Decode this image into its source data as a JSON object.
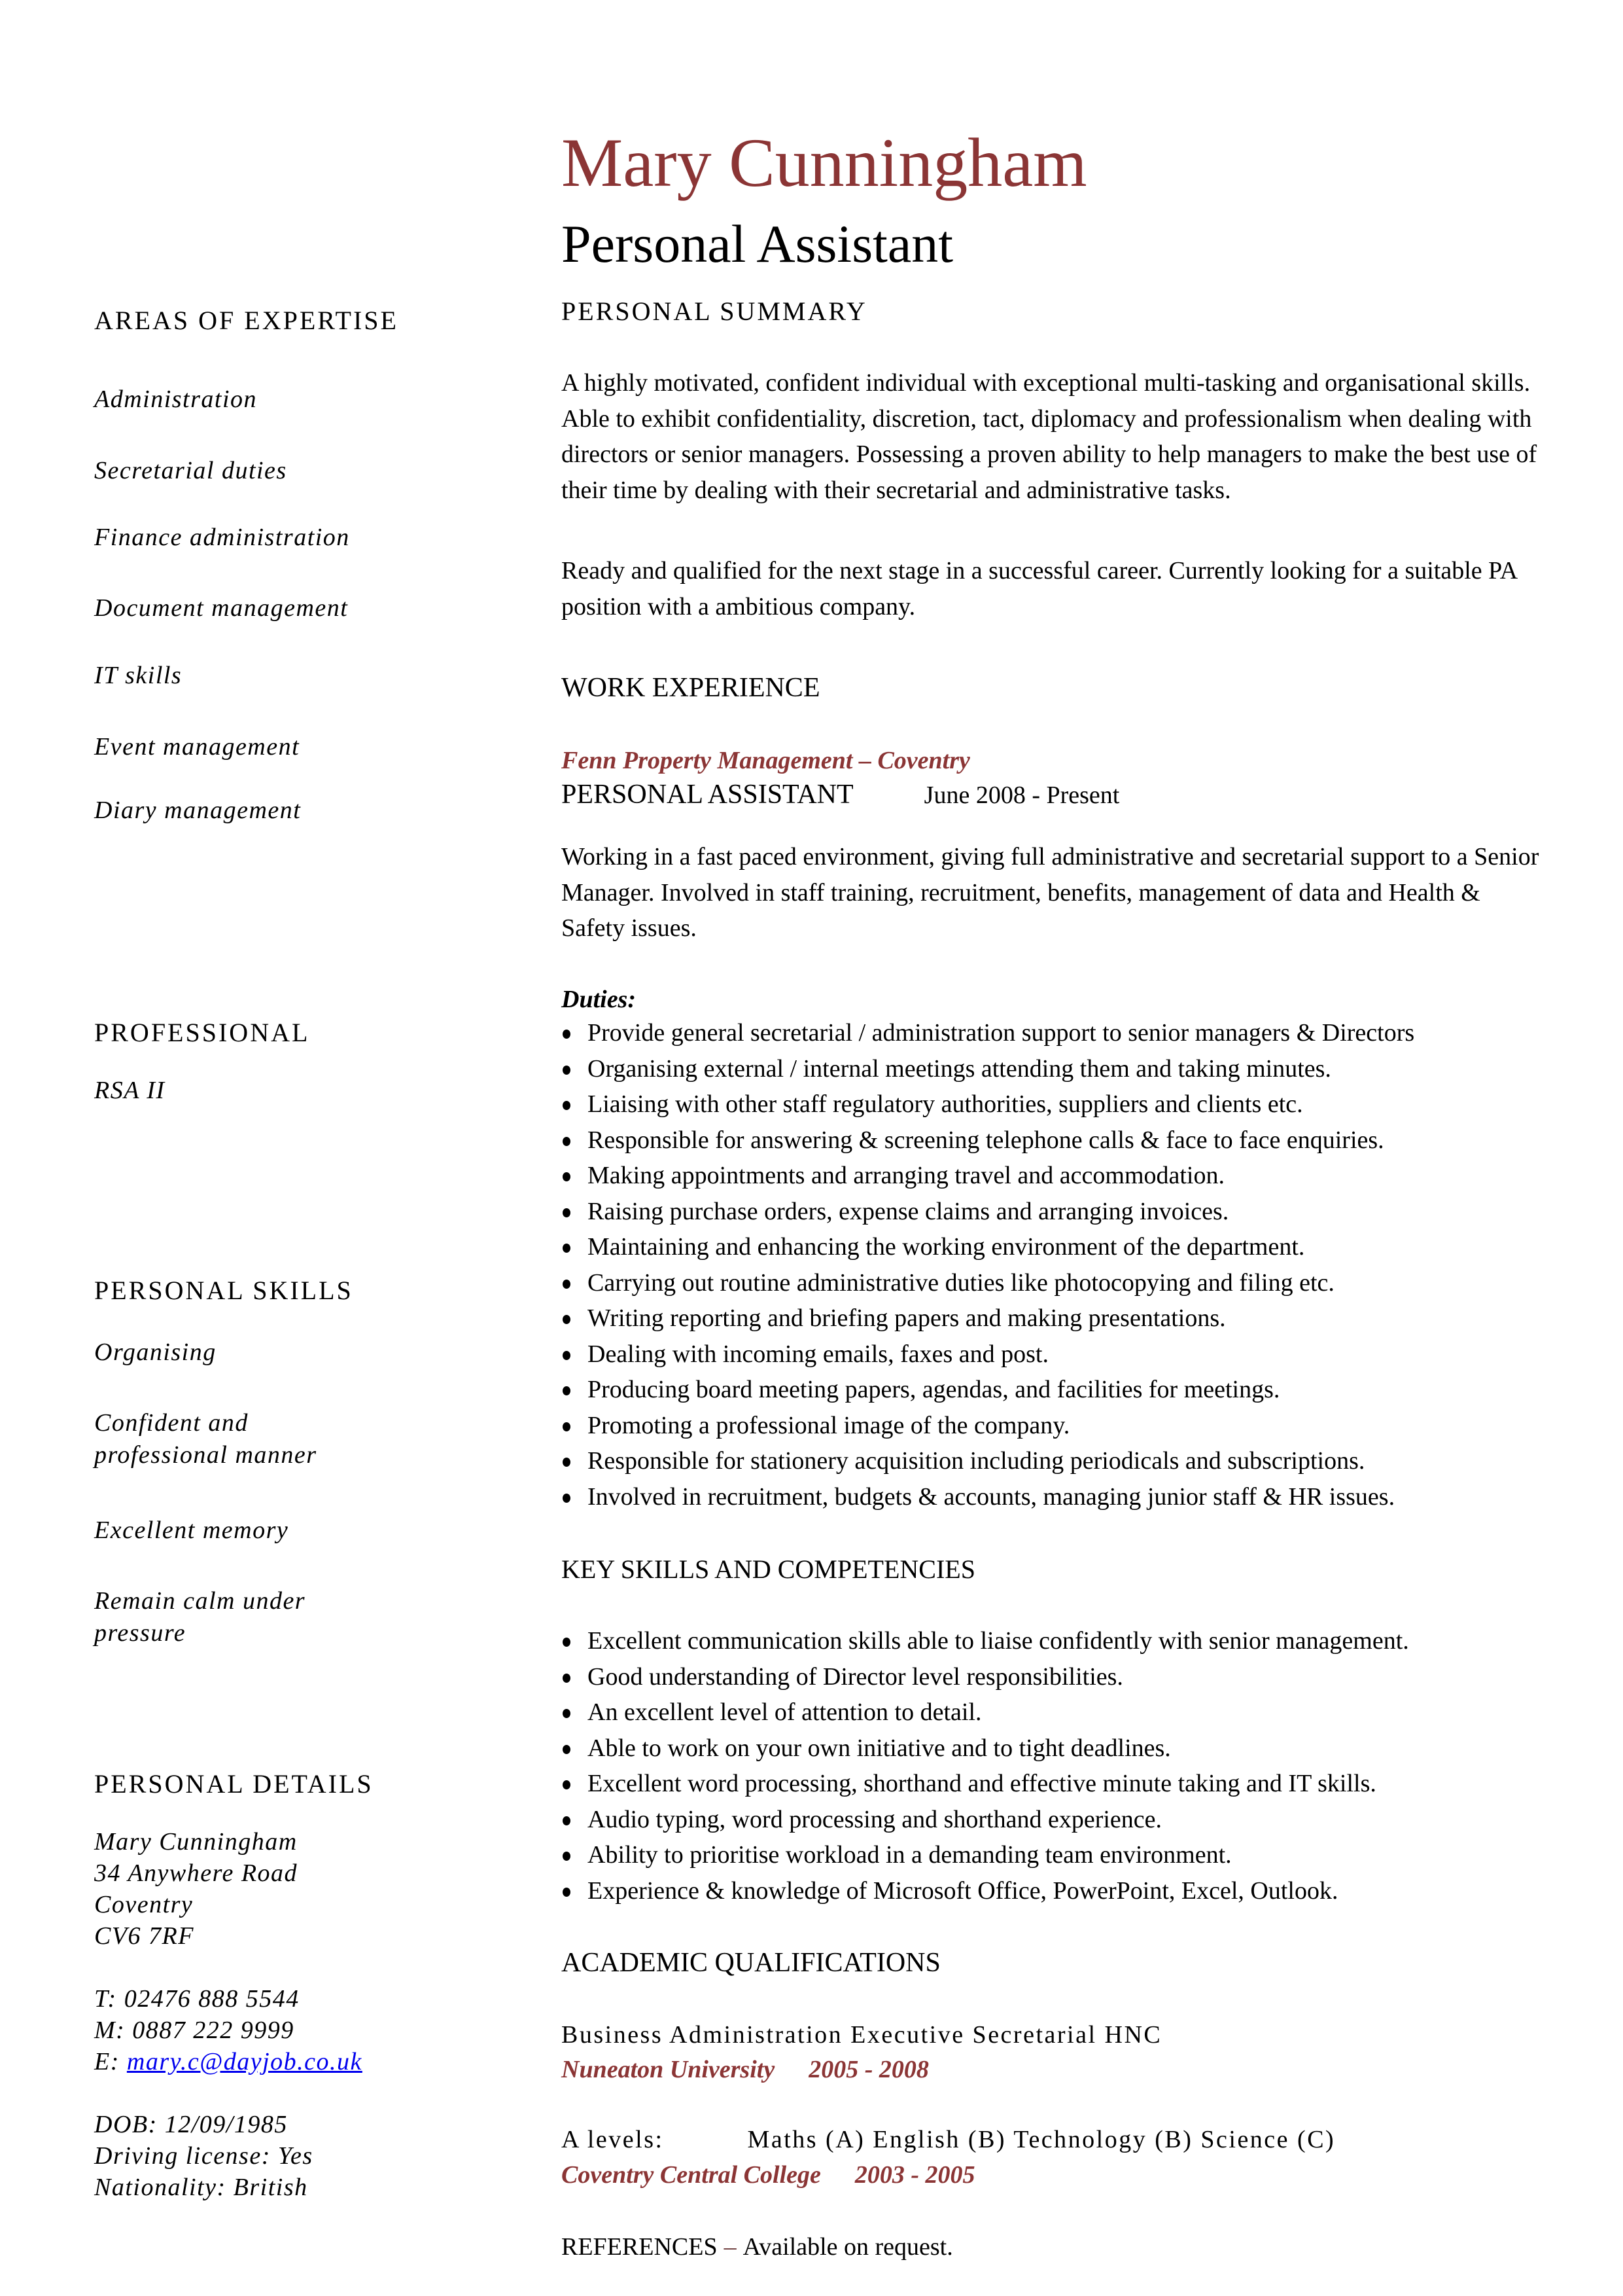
{
  "header": {
    "name": "Mary Cunningham",
    "job_title": "Personal Assistant",
    "accent_color": "#8B3535"
  },
  "left_column": {
    "areas_of_expertise": {
      "heading": "AREAS OF EXPERTISE",
      "items": [
        "Administration",
        "Secretarial duties",
        "Finance administration",
        "Document management",
        "IT skills",
        "Event management",
        "Diary management"
      ]
    },
    "professional": {
      "heading": "PROFESSIONAL",
      "items": [
        "RSA II"
      ]
    },
    "personal_skills": {
      "heading": "PERSONAL SKILLS",
      "items": [
        {
          "line1": "Organising",
          "line2": ""
        },
        {
          "line1": "Confident and",
          "line2": "professional manner"
        },
        {
          "line1": "Excellent memory",
          "line2": ""
        },
        {
          "line1": "Remain calm under",
          "line2": "pressure"
        }
      ]
    },
    "personal_details": {
      "heading": "PERSONAL DETAILS",
      "name": "Mary Cunningham",
      "address_line1": "34 Anywhere Road",
      "city": "Coventry",
      "postcode": "CV6 7RF",
      "telephone": "T: 02476 888 5544",
      "mobile": "M: 0887 222 9999",
      "email_label": "E: ",
      "email": "mary.c@dayjob.co.uk",
      "link_color": "#0000EE",
      "dob": "DOB: 12/09/1985",
      "driving_license": "Driving license:  Yes",
      "nationality": "Nationality: British"
    }
  },
  "personal_summary": {
    "heading": "PERSONAL SUMMARY",
    "paragraph1": "A highly motivated, confident individual with exceptional multi-tasking and organisational skills. Able to exhibit confidentiality, discretion, tact, diplomacy and professionalism when dealing with directors or senior managers. Possessing a proven ability to help managers to make the best use of their time by dealing with their secretarial and administrative tasks.",
    "paragraph2": "Ready and qualified for the next stage in a successful career. Currently looking for a suitable PA position with a ambitious company."
  },
  "work_experience": {
    "heading": "WORK EXPERIENCE",
    "company": "Fenn Property Management  – Coventry",
    "position": "PERSONAL ASSISTANT",
    "dates": "June 2008 - Present",
    "description": "Working in a fast paced environment, giving full administrative and secretarial support to a Senior Manager. Involved in staff training, recruitment, benefits, management of data and Health & Safety issues.",
    "duties_label": "Duties:",
    "duties": [
      "Provide general secretarial / administration support to senior managers & Directors",
      "Organising external / internal meetings attending them and taking minutes.",
      "Liaising with other staff regulatory authorities, suppliers and clients etc.",
      "Responsible for answering & screening telephone calls & face to face enquiries.",
      "Making appointments and arranging travel and accommodation.",
      "Raising purchase orders, expense claims and arranging invoices.",
      "Maintaining and enhancing the working environment of the department.",
      "Carrying out routine administrative duties like photocopying and filing etc.",
      "Writing reporting and briefing papers and making presentations.",
      "Dealing with incoming emails, faxes and post.",
      "Producing board meeting papers, agendas, and facilities for meetings.",
      "Promoting a professional image of the company.",
      "Responsible for stationery acquisition including periodicals and subscriptions.",
      "Involved in recruitment, budgets & accounts, managing junior staff & HR issues."
    ]
  },
  "key_skills": {
    "heading": "KEY SKILLS AND COMPETENCIES",
    "items": [
      "Excellent communication skills able to liaise confidently with senior management.",
      "Good understanding of Director level responsibilities.",
      "An excellent level of attention to detail.",
      "Able to work on your own initiative and to tight deadlines.",
      "Excellent word processing, shorthand and effective minute taking and IT skills.",
      "Audio typing, word processing and shorthand experience.",
      "Ability to prioritise workload in a demanding team environment.",
      "Experience & knowledge of Microsoft Office, PowerPoint, Excel, Outlook."
    ]
  },
  "academic": {
    "heading": "ACADEMIC QUALIFICATIONS",
    "qualifications": [
      {
        "title": "Business Administration Executive Secretarial HNC",
        "label": "",
        "institution": "Nuneaton University",
        "years": "2005 - 2008"
      },
      {
        "title": "Maths (A) English (B) Technology (B) Science (C)",
        "label": "A levels:",
        "institution": "Coventry Central College",
        "years": "2003 - 2005"
      }
    ]
  },
  "references": {
    "label": "REFERENCES",
    "dash": "–",
    "text": "Available on request."
  }
}
